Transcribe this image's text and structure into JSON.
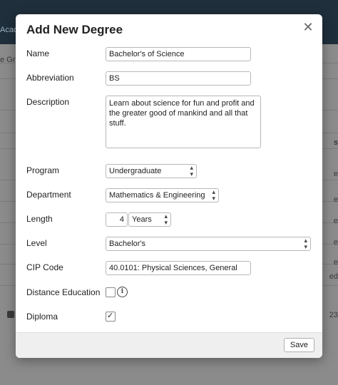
{
  "background": {
    "tab_label": "Acad",
    "left_text": "e Gr",
    "right_values": [
      "s",
      "e",
      "e",
      "e",
      "e",
      "e",
      "ed",
      "23"
    ]
  },
  "modal": {
    "title": "Add New Degree",
    "close_icon": "close-icon",
    "fields": {
      "name": {
        "label": "Name",
        "value": "Bachelor's of Science"
      },
      "abbreviation": {
        "label": "Abbreviation",
        "value": "BS"
      },
      "description": {
        "label": "Description",
        "value": "Learn about science for fun and profit and the greater good of mankind and all that stuff."
      },
      "program": {
        "label": "Program",
        "value": "Undergraduate"
      },
      "department": {
        "label": "Department",
        "value": "Mathematics & Engineering"
      },
      "length": {
        "label": "Length",
        "value": "4",
        "unit": "Years"
      },
      "level": {
        "label": "Level",
        "value": "Bachelor's"
      },
      "cip_code": {
        "label": "CIP Code",
        "value": "40.0101: Physical Sciences, General"
      },
      "distance_education": {
        "label": "Distance Education",
        "checked": false
      },
      "diploma": {
        "label": "Diploma",
        "checked": true
      }
    },
    "save_label": "Save"
  }
}
